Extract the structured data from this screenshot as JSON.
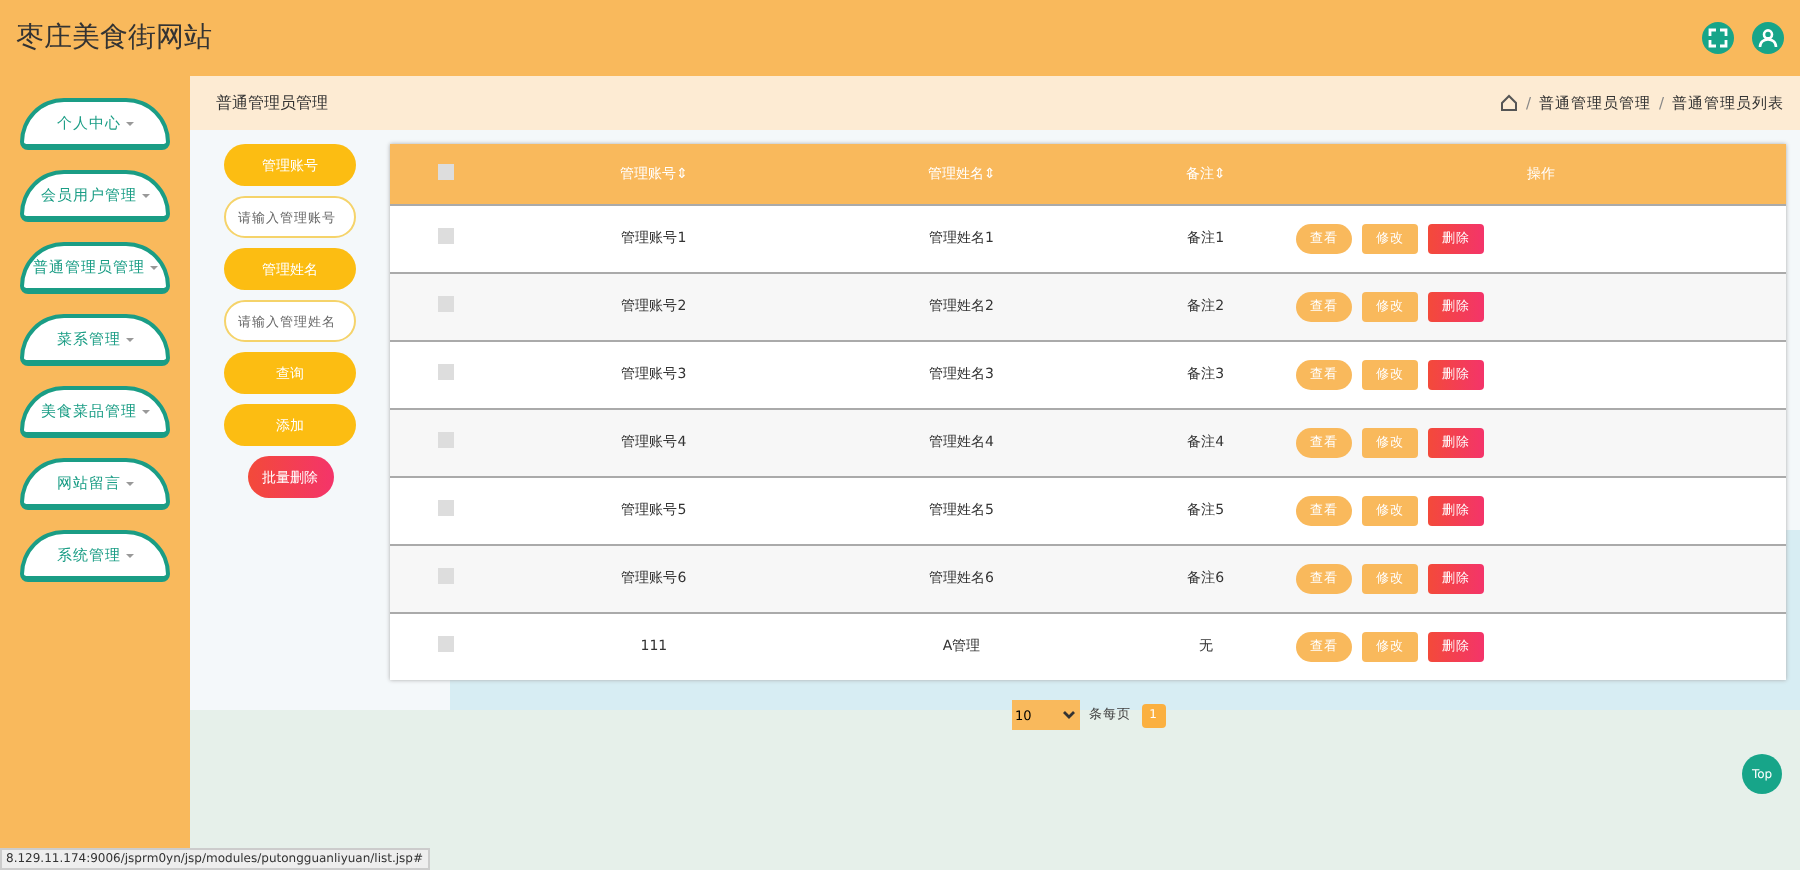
{
  "header": {
    "title": "枣庄美食街网站"
  },
  "sidebar": {
    "items": [
      {
        "label": "个人中心",
        "expanded": false
      },
      {
        "label": "会员用户管理",
        "expanded": false
      },
      {
        "label": "普通管理员管理",
        "expanded": false
      },
      {
        "label": "菜系管理",
        "expanded": false
      },
      {
        "label": "美食菜品管理",
        "expanded": false
      },
      {
        "label": "网站留言",
        "expanded": false
      },
      {
        "label": "系统管理",
        "expanded": false
      }
    ]
  },
  "page_title": "普通管理员管理",
  "breadcrumb": [
    {
      "kind": "separator",
      "text": "/"
    },
    {
      "kind": "link",
      "text": "普通管理员管理"
    },
    {
      "kind": "separator",
      "text": "/"
    },
    {
      "kind": "link",
      "text": "普通管理员列表"
    }
  ],
  "search": {
    "items": [
      {
        "kind": "label",
        "text": "管理账号"
      },
      {
        "kind": "field",
        "placeholder": "请输入管理账号"
      },
      {
        "kind": "label",
        "text": "管理姓名"
      },
      {
        "kind": "field",
        "placeholder": "请输入管理姓名"
      }
    ],
    "buttons": [
      {
        "kind": "primary",
        "label": "查询"
      },
      {
        "kind": "primary",
        "label": "添加"
      },
      {
        "kind": "danger",
        "label": "批量删除"
      }
    ]
  },
  "table": {
    "select_all": {
      "checked": false
    },
    "columns": [
      "管理账号⇕",
      "管理姓名⇕",
      "备注⇕",
      "操作"
    ],
    "rows": [
      {
        "checked": false,
        "cells": [
          "管理账号1",
          "管理姓名1",
          "备注1"
        ]
      },
      {
        "checked": false,
        "cells": [
          "管理账号2",
          "管理姓名2",
          "备注2"
        ]
      },
      {
        "checked": false,
        "cells": [
          "管理账号3",
          "管理姓名3",
          "备注3"
        ]
      },
      {
        "checked": false,
        "cells": [
          "管理账号4",
          "管理姓名4",
          "备注4"
        ]
      },
      {
        "checked": false,
        "cells": [
          "管理账号5",
          "管理姓名5",
          "备注5"
        ]
      },
      {
        "checked": false,
        "cells": [
          "管理账号6",
          "管理姓名6",
          "备注6"
        ]
      },
      {
        "checked": false,
        "cells": [
          "111",
          "A管理",
          "无"
        ]
      }
    ],
    "row_actions": [
      [
        {
          "kind": "view",
          "label": "查看"
        },
        {
          "kind": "edit",
          "label": "修改"
        },
        {
          "kind": "delete",
          "label": "删除"
        }
      ],
      [
        {
          "kind": "view",
          "label": "查看"
        },
        {
          "kind": "edit",
          "label": "修改"
        },
        {
          "kind": "delete",
          "label": "删除"
        }
      ],
      [
        {
          "kind": "view",
          "label": "查看"
        },
        {
          "kind": "edit",
          "label": "修改"
        },
        {
          "kind": "delete",
          "label": "删除"
        }
      ],
      [
        {
          "kind": "view",
          "label": "查看"
        },
        {
          "kind": "edit",
          "label": "修改"
        },
        {
          "kind": "delete",
          "label": "删除"
        }
      ],
      [
        {
          "kind": "view",
          "label": "查看"
        },
        {
          "kind": "edit",
          "label": "修改"
        },
        {
          "kind": "delete",
          "label": "删除"
        }
      ],
      [
        {
          "kind": "view",
          "label": "查看"
        },
        {
          "kind": "edit",
          "label": "修改"
        },
        {
          "kind": "delete",
          "label": "删除"
        }
      ],
      [
        {
          "kind": "view",
          "label": "查看"
        },
        {
          "kind": "edit",
          "label": "修改"
        },
        {
          "kind": "delete",
          "label": "删除"
        }
      ]
    ]
  },
  "pagination": {
    "page_size": "10",
    "page_size_label": "条每页",
    "pages": [
      {
        "label": "1",
        "selected": true
      }
    ]
  },
  "top_button": "Top",
  "status_bar": "8.129.11.174:9006/jsprm0yn/jsp/modules/putongguanliyuan/list.jsp#"
}
